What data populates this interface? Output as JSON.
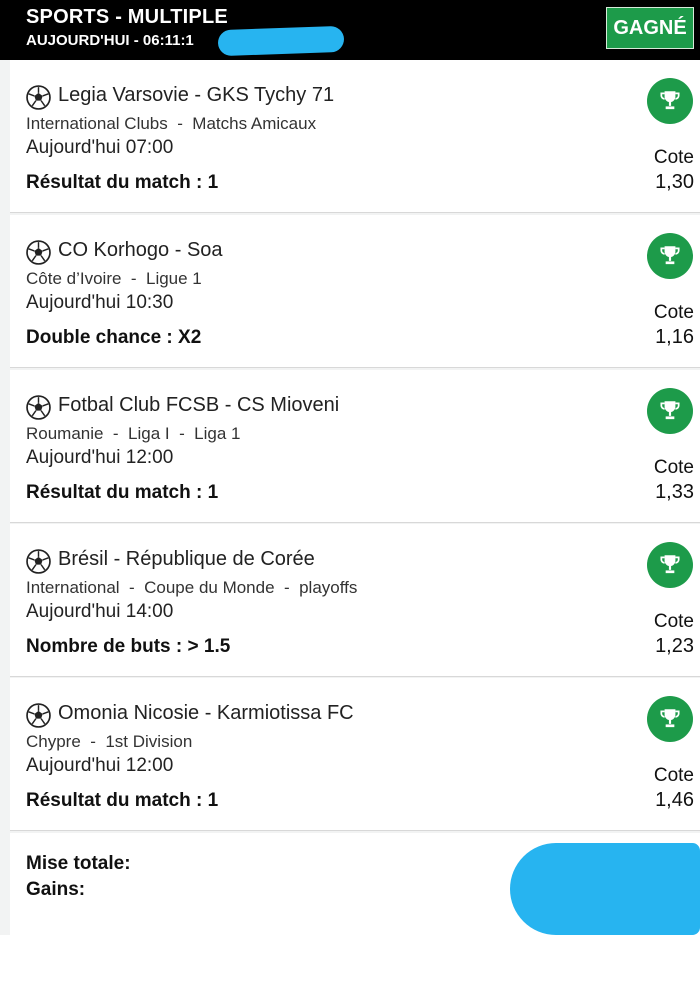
{
  "header": {
    "title": "SPORTS - MULTIPLE",
    "subtitle": "AUJOURD'HUI - 06:11:1",
    "status": "GAGNÉ"
  },
  "colors": {
    "accent_green": "#1d9b4a",
    "header_bg": "#000000",
    "redaction": "#27b4f0"
  },
  "icons": {
    "sport": "football-icon",
    "win": "trophy-icon"
  },
  "bets": [
    {
      "match": "Legia Varsovie - GKS Tychy 71",
      "league": "International Clubs  -  Matchs Amicaux",
      "time": "Aujourd'hui 07:00",
      "bet": "Résultat du match : 1",
      "cote_label": "Cote",
      "cote": "1,30"
    },
    {
      "match": "CO Korhogo - Soa",
      "league": "Côte d’Ivoire  -  Ligue 1",
      "time": "Aujourd'hui 10:30",
      "bet": "Double chance : X2",
      "cote_label": "Cote",
      "cote": "1,16"
    },
    {
      "match": "Fotbal Club FCSB - CS Mioveni",
      "league": "Roumanie  -  Liga I  -  Liga 1",
      "time": "Aujourd'hui 12:00",
      "bet": "Résultat du match : 1",
      "cote_label": "Cote",
      "cote": "1,33"
    },
    {
      "match": "Brésil - République de Corée",
      "league": "International  -  Coupe du Monde  -  playoffs",
      "time": "Aujourd'hui 14:00",
      "bet": "Nombre de buts : > 1.5",
      "cote_label": "Cote",
      "cote": "1,23"
    },
    {
      "match": "Omonia Nicosie - Karmiotissa FC",
      "league": "Chypre  -  1st Division",
      "time": "Aujourd'hui 12:00",
      "bet": "Résultat du match : 1",
      "cote_label": "Cote",
      "cote": "1,46"
    }
  ],
  "summary": {
    "stake_label": "Mise totale:",
    "gains_label": "Gains:"
  }
}
